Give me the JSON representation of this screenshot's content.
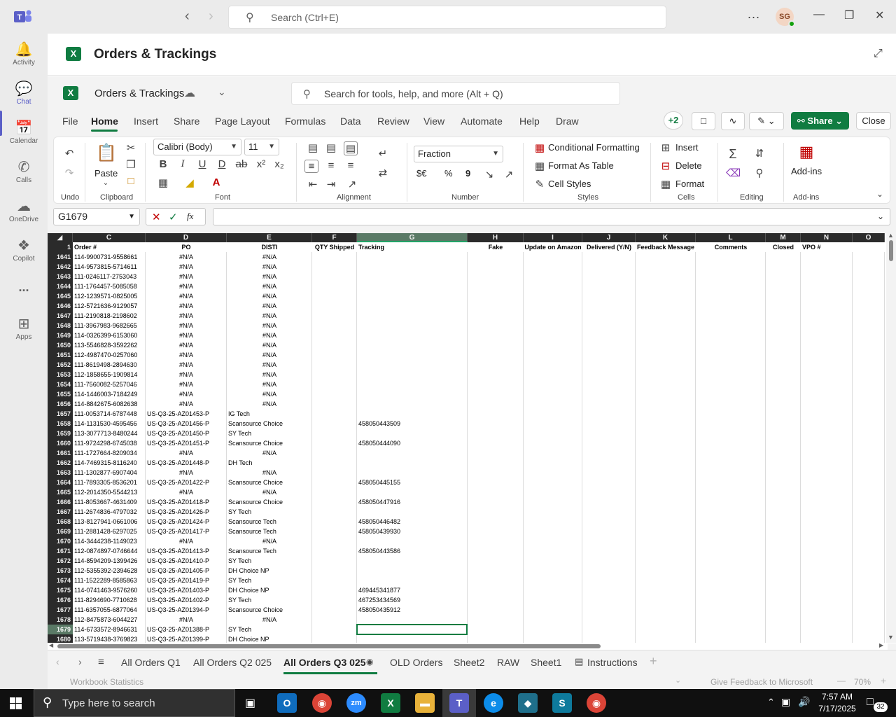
{
  "teams": {
    "search_placeholder": "Search (Ctrl+E)",
    "avatar_initials": "SG",
    "rail": [
      {
        "label": "Activity",
        "icon": "bell-icon"
      },
      {
        "label": "Chat",
        "icon": "chat-icon"
      },
      {
        "label": "Calendar",
        "icon": "calendar-icon"
      },
      {
        "label": "Calls",
        "icon": "phone-icon"
      },
      {
        "label": "OneDrive",
        "icon": "cloud-icon"
      },
      {
        "label": "Copilot",
        "icon": "copilot-icon"
      },
      {
        "label": "Apps",
        "icon": "add-app-icon"
      }
    ],
    "more_glyph": "..."
  },
  "app": {
    "title": "Orders & Trackings"
  },
  "excel": {
    "doc_name": "Orders & Trackings",
    "tool_search_placeholder": "Search for tools, help, and more (Alt + Q)",
    "tabs": [
      "File",
      "Home",
      "Insert",
      "Share",
      "Page Layout",
      "Formulas",
      "Data",
      "Review",
      "View",
      "Automate",
      "Help",
      "Draw"
    ],
    "active_tab": "Home",
    "collab_count": "+2",
    "share_label": "Share",
    "close_label": "Close",
    "ribbon": {
      "groups": [
        "Undo",
        "Clipboard",
        "Font",
        "Alignment",
        "Number",
        "Styles",
        "Cells",
        "Editing",
        "Add-ins"
      ],
      "paste": "Paste",
      "font_name": "Calibri (Body)",
      "font_size": "11",
      "number_format": "Fraction",
      "conditional_formatting": "Conditional Formatting",
      "format_as_table": "Format As Table",
      "cell_styles": "Cell Styles",
      "insert": "Insert",
      "delete": "Delete",
      "format": "Format",
      "addins": "Add-ins",
      "number_symbols": [
        "$€",
        "%",
        "9"
      ]
    },
    "name_box": "G1679",
    "formula": "",
    "columns": [
      {
        "letter": "C",
        "header": "Order #"
      },
      {
        "letter": "D",
        "header": "PO"
      },
      {
        "letter": "E",
        "header": "DISTI"
      },
      {
        "letter": "F",
        "header": "QTY Shipped"
      },
      {
        "letter": "G",
        "header": "Tracking"
      },
      {
        "letter": "H",
        "header": "Fake"
      },
      {
        "letter": "I",
        "header": "Update on Amazon"
      },
      {
        "letter": "J",
        "header": "Delivered (Y/N)"
      },
      {
        "letter": "K",
        "header": "Feedback Message"
      },
      {
        "letter": "L",
        "header": "Comments"
      },
      {
        "letter": "M",
        "header": "Closed"
      },
      {
        "letter": "N",
        "header": "VPO #"
      },
      {
        "letter": "O",
        "header": ""
      }
    ],
    "header_row_number": "1",
    "rows": [
      {
        "n": "1641",
        "order": "114-9900731-9558661",
        "po": "#N/A",
        "disti": "#N/A",
        "tracking": ""
      },
      {
        "n": "1642",
        "order": "114-9573815-5714611",
        "po": "#N/A",
        "disti": "#N/A",
        "tracking": ""
      },
      {
        "n": "1643",
        "order": "111-0246117-2753043",
        "po": "#N/A",
        "disti": "#N/A",
        "tracking": ""
      },
      {
        "n": "1644",
        "order": "111-1764457-5085058",
        "po": "#N/A",
        "disti": "#N/A",
        "tracking": ""
      },
      {
        "n": "1645",
        "order": "112-1239571-0825005",
        "po": "#N/A",
        "disti": "#N/A",
        "tracking": ""
      },
      {
        "n": "1646",
        "order": "112-5721636-9129057",
        "po": "#N/A",
        "disti": "#N/A",
        "tracking": ""
      },
      {
        "n": "1647",
        "order": "111-2190818-2198602",
        "po": "#N/A",
        "disti": "#N/A",
        "tracking": ""
      },
      {
        "n": "1648",
        "order": "111-3967983-9682665",
        "po": "#N/A",
        "disti": "#N/A",
        "tracking": ""
      },
      {
        "n": "1649",
        "order": "114-0326399-6153060",
        "po": "#N/A",
        "disti": "#N/A",
        "tracking": ""
      },
      {
        "n": "1650",
        "order": "113-5546828-3592262",
        "po": "#N/A",
        "disti": "#N/A",
        "tracking": ""
      },
      {
        "n": "1651",
        "order": "112-4987470-0257060",
        "po": "#N/A",
        "disti": "#N/A",
        "tracking": ""
      },
      {
        "n": "1652",
        "order": "111-8619498-2894630",
        "po": "#N/A",
        "disti": "#N/A",
        "tracking": ""
      },
      {
        "n": "1653",
        "order": "112-1858655-1909814",
        "po": "#N/A",
        "disti": "#N/A",
        "tracking": ""
      },
      {
        "n": "1654",
        "order": "111-7560082-5257046",
        "po": "#N/A",
        "disti": "#N/A",
        "tracking": ""
      },
      {
        "n": "1655",
        "order": "114-1446003-7184249",
        "po": "#N/A",
        "disti": "#N/A",
        "tracking": ""
      },
      {
        "n": "1656",
        "order": "114-8842675-6082638",
        "po": "#N/A",
        "disti": "#N/A",
        "tracking": ""
      },
      {
        "n": "1657",
        "order": "111-0053714-6787448",
        "po": "US-Q3-25-AZ01453-P",
        "disti": "IG Tech",
        "tracking": ""
      },
      {
        "n": "1658",
        "order": "114-1131530-4595456",
        "po": "US-Q3-25-AZ01456-P",
        "disti": "Scansource Choice",
        "tracking": "458050443509"
      },
      {
        "n": "1659",
        "order": "113-3077713-8480244",
        "po": "US-Q3-25-AZ01450-P",
        "disti": "SY Tech",
        "tracking": ""
      },
      {
        "n": "1660",
        "order": "111-9724298-6745038",
        "po": "US-Q3-25-AZ01451-P",
        "disti": "Scansource Choice",
        "tracking": "458050444090"
      },
      {
        "n": "1661",
        "order": "111-1727664-8209034",
        "po": "#N/A",
        "disti": "#N/A",
        "tracking": ""
      },
      {
        "n": "1662",
        "order": "114-7469315-8116240",
        "po": "US-Q3-25-AZ01448-P",
        "disti": "DH Tech",
        "tracking": ""
      },
      {
        "n": "1663",
        "order": "111-1302877-6907404",
        "po": "#N/A",
        "disti": "#N/A",
        "tracking": ""
      },
      {
        "n": "1664",
        "order": "111-7893305-8536201",
        "po": "US-Q3-25-AZ01422-P",
        "disti": "Scansource Choice",
        "tracking": "458050445155"
      },
      {
        "n": "1665",
        "order": "112-2014350-5544213",
        "po": "#N/A",
        "disti": "#N/A",
        "tracking": ""
      },
      {
        "n": "1666",
        "order": "111-8053667-4631409",
        "po": "US-Q3-25-AZ01418-P",
        "disti": "Scansource Choice",
        "tracking": "458050447916"
      },
      {
        "n": "1667",
        "order": "111-2674836-4797032",
        "po": "US-Q3-25-AZ01426-P",
        "disti": "SY Tech",
        "tracking": ""
      },
      {
        "n": "1668",
        "order": "113-8127941-0661006",
        "po": "US-Q3-25-AZ01424-P",
        "disti": "Scansource Tech",
        "tracking": "458050446482"
      },
      {
        "n": "1669",
        "order": "111-2881428-6297025",
        "po": "US-Q3-25-AZ01417-P",
        "disti": "Scansource Tech",
        "tracking": "458050439930"
      },
      {
        "n": "1670",
        "order": "114-3444238-1149023",
        "po": "#N/A",
        "disti": "#N/A",
        "tracking": ""
      },
      {
        "n": "1671",
        "order": "112-0874897-0746644",
        "po": "US-Q3-25-AZ01413-P",
        "disti": "Scansource Tech",
        "tracking": "458050443586"
      },
      {
        "n": "1672",
        "order": "114-8594209-1399426",
        "po": "US-Q3-25-AZ01410-P",
        "disti": "SY Tech",
        "tracking": ""
      },
      {
        "n": "1673",
        "order": "112-5355392-2394628",
        "po": "US-Q3-25-AZ01405-P",
        "disti": "DH Choice NP",
        "tracking": ""
      },
      {
        "n": "1674",
        "order": "111-1522289-8585863",
        "po": "US-Q3-25-AZ01419-P",
        "disti": "SY Tech",
        "tracking": ""
      },
      {
        "n": "1675",
        "order": "114-0741463-9576260",
        "po": "US-Q3-25-AZ01403-P",
        "disti": "DH Choice NP",
        "tracking": "469445341877"
      },
      {
        "n": "1676",
        "order": "111-8294690-7710628",
        "po": "US-Q3-25-AZ01402-P",
        "disti": "SY Tech",
        "tracking": "467253434569"
      },
      {
        "n": "1677",
        "order": "111-6357055-6877064",
        "po": "US-Q3-25-AZ01394-P",
        "disti": "Scansource Choice",
        "tracking": "458050435912"
      },
      {
        "n": "1678",
        "order": "112-8475873-6044227",
        "po": "#N/A",
        "disti": "#N/A",
        "tracking": ""
      },
      {
        "n": "1679",
        "order": "114-6733572-8946631",
        "po": "US-Q3-25-AZ01388-P",
        "disti": "SY Tech",
        "tracking": ""
      },
      {
        "n": "1680",
        "order": "113-5719438-3769823",
        "po": "US-Q3-25-AZ01399-P",
        "disti": "DH Choice NP",
        "tracking": ""
      }
    ],
    "sheet_tabs": [
      "All Orders Q1",
      "All Orders Q2 025",
      "All Orders Q3 025",
      "OLD Orders",
      "Sheet2",
      "RAW",
      "Sheet1",
      "Instructions"
    ],
    "active_sheet": "All Orders Q3 025",
    "status_left": "Workbook Statistics",
    "status_feedback": "Give Feedback to Microsoft",
    "zoom": "70%"
  },
  "taskbar": {
    "search_placeholder": "Type here to search",
    "time": "7:57 AM",
    "date": "7/17/2025",
    "notif_count": "32"
  }
}
